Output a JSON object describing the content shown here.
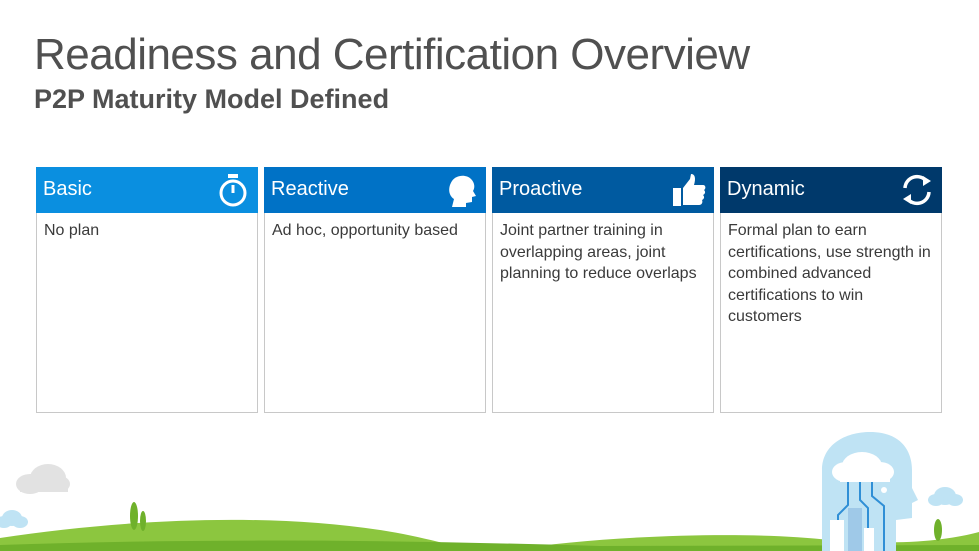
{
  "title": "Readiness and Certification Overview",
  "subtitle": "P2P Maturity Model Defined",
  "cards": [
    {
      "label": "Basic",
      "description": "No plan",
      "color": "#0a8fe0",
      "icon": "stopwatch-icon"
    },
    {
      "label": "Reactive",
      "description": "Ad hoc, opportunity based",
      "color": "#0072c6",
      "icon": "head-profile-icon"
    },
    {
      "label": "Proactive",
      "description": "Joint partner training in overlapping areas, joint planning to reduce overlaps",
      "color": "#005aa0",
      "icon": "thumbs-up-icon"
    },
    {
      "label": "Dynamic",
      "description": "Formal plan to earn certifications, use strength in combined advanced certifications to win customers",
      "color": "#00396b",
      "icon": "refresh-cycle-icon"
    }
  ]
}
